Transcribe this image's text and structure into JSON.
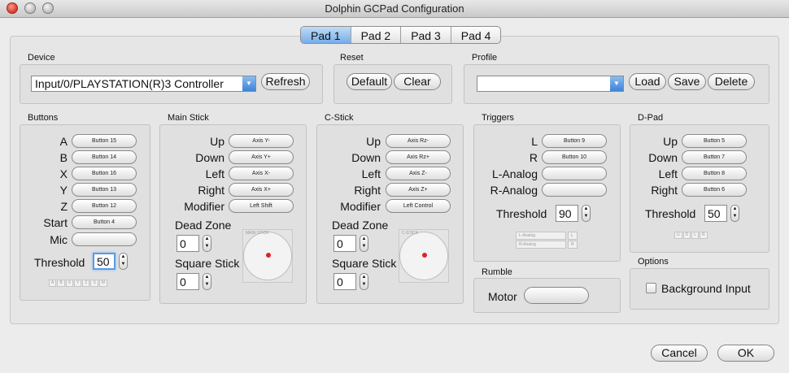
{
  "window": {
    "title": "Dolphin GCPad Configuration"
  },
  "tabs": [
    {
      "label": "Pad 1",
      "active": true
    },
    {
      "label": "Pad 2",
      "active": false
    },
    {
      "label": "Pad 3",
      "active": false
    },
    {
      "label": "Pad 4",
      "active": false
    }
  ],
  "device": {
    "label": "Device",
    "selected": "Input/0/PLAYSTATION(R)3 Controller",
    "refresh": "Refresh"
  },
  "reset": {
    "label": "Reset",
    "default": "Default",
    "clear": "Clear"
  },
  "profile": {
    "label": "Profile",
    "selected": "",
    "load": "Load",
    "save": "Save",
    "delete": "Delete"
  },
  "buttons": {
    "label": "Buttons",
    "rows": [
      {
        "name": "A",
        "binding": "Button 15"
      },
      {
        "name": "B",
        "binding": "Button 14"
      },
      {
        "name": "X",
        "binding": "Button 16"
      },
      {
        "name": "Y",
        "binding": "Button 13"
      },
      {
        "name": "Z",
        "binding": "Button 12"
      },
      {
        "name": "Start",
        "binding": "Button 4"
      },
      {
        "name": "Mic",
        "binding": ""
      }
    ],
    "threshold_label": "Threshold",
    "threshold": "50",
    "indicators": [
      "A",
      "B",
      "X",
      "Y",
      "Z",
      "S",
      "M"
    ]
  },
  "main_stick": {
    "label": "Main Stick",
    "rows": [
      {
        "name": "Up",
        "binding": "Axis Y-"
      },
      {
        "name": "Down",
        "binding": "Axis Y+"
      },
      {
        "name": "Left",
        "binding": "Axis X-"
      },
      {
        "name": "Right",
        "binding": "Axis X+"
      },
      {
        "name": "Modifier",
        "binding": "Left Shift"
      }
    ],
    "dead_zone_label": "Dead Zone",
    "dead_zone": "0",
    "square_stick_label": "Square Stick",
    "square_stick": "0",
    "preview_caption": "MAIN STICK"
  },
  "c_stick": {
    "label": "C-Stick",
    "rows": [
      {
        "name": "Up",
        "binding": "Axis Rz-"
      },
      {
        "name": "Down",
        "binding": "Axis Rz+"
      },
      {
        "name": "Left",
        "binding": "Axis Z-"
      },
      {
        "name": "Right",
        "binding": "Axis Z+"
      },
      {
        "name": "Modifier",
        "binding": "Left Control"
      }
    ],
    "dead_zone_label": "Dead Zone",
    "dead_zone": "0",
    "square_stick_label": "Square Stick",
    "square_stick": "0",
    "preview_caption": "C-STICK"
  },
  "triggers": {
    "label": "Triggers",
    "rows": [
      {
        "name": "L",
        "binding": "Button 9"
      },
      {
        "name": "R",
        "binding": "Button 10"
      },
      {
        "name": "L-Analog",
        "binding": ""
      },
      {
        "name": "R-Analog",
        "binding": ""
      }
    ],
    "threshold_label": "Threshold",
    "threshold": "90",
    "bars": [
      {
        "label": "L-Analog",
        "end": "L"
      },
      {
        "label": "R-Analog",
        "end": "R"
      }
    ]
  },
  "dpad": {
    "label": "D-Pad",
    "rows": [
      {
        "name": "Up",
        "binding": "Button 5"
      },
      {
        "name": "Down",
        "binding": "Button 7"
      },
      {
        "name": "Left",
        "binding": "Button 8"
      },
      {
        "name": "Right",
        "binding": "Button 6"
      }
    ],
    "threshold_label": "Threshold",
    "threshold": "50",
    "indicators": [
      "U",
      "D",
      "L",
      "R"
    ]
  },
  "rumble": {
    "label": "Rumble",
    "motor_label": "Motor",
    "motor_binding": ""
  },
  "options": {
    "label": "Options",
    "background_input": "Background Input",
    "background_input_checked": false
  },
  "footer": {
    "cancel": "Cancel",
    "ok": "OK"
  }
}
